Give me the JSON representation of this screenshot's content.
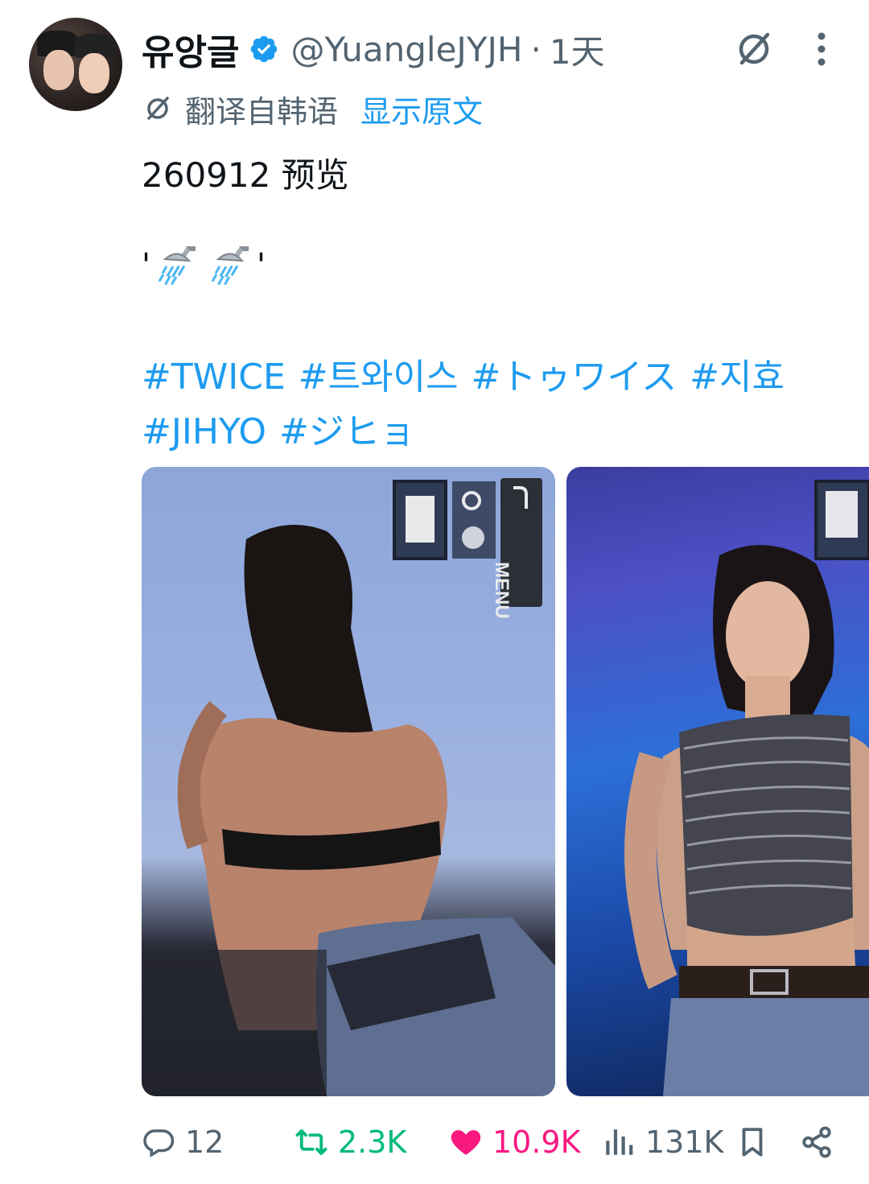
{
  "author": {
    "display_name": "유앙글",
    "handle": "@YuangleJYJH",
    "separator": "·",
    "time": "1天"
  },
  "translation": {
    "translated_from": "翻译自韩语",
    "show_original": "显示原文"
  },
  "tweet": {
    "line1": "260912 预览",
    "quote_open": "'",
    "quote_close": "'",
    "emoji_names": [
      "shower-icon",
      "shower-icon"
    ],
    "hashtags_row1": [
      "#TWICE",
      "#트와이스",
      "#トゥワイス",
      "#지효"
    ],
    "hashtags_row2": [
      "#JIHYO",
      "#ジヒョ"
    ]
  },
  "photo_overlay": {
    "menu_label": "MENU"
  },
  "actions": {
    "replies": "12",
    "reposts": "2.3K",
    "likes": "10.9K",
    "views": "131K"
  },
  "colors": {
    "link": "#1d9bf0",
    "muted": "#536471",
    "repost": "#00ba7c",
    "like": "#f91880",
    "verified": "#1d9bf0"
  }
}
